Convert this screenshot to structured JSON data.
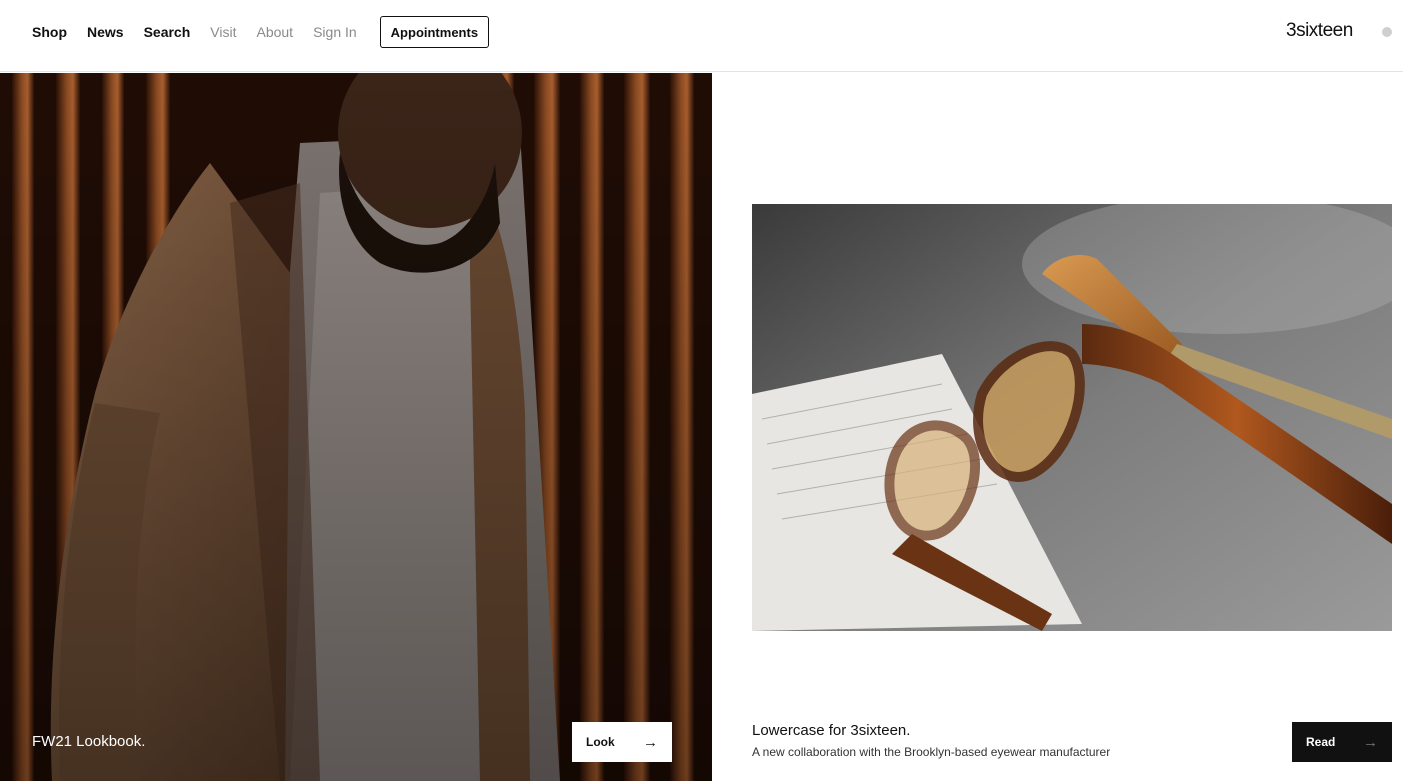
{
  "nav": {
    "items": [
      {
        "label": "Shop"
      },
      {
        "label": "News"
      },
      {
        "label": "Search"
      },
      {
        "label": "Visit"
      },
      {
        "label": "About"
      },
      {
        "label": "Sign In"
      }
    ],
    "appointments_label": "Appointments"
  },
  "brand": {
    "logo_text": "3sixteen"
  },
  "feature_left": {
    "caption": "FW21 Lookbook.",
    "button_label": "Look",
    "arrow": "→"
  },
  "feature_right": {
    "title": "Lowercase for 3sixteen.",
    "subtitle": "A new collaboration with the Brooklyn-based eyewear manufacturer",
    "button_label": "Read",
    "arrow": "→"
  }
}
